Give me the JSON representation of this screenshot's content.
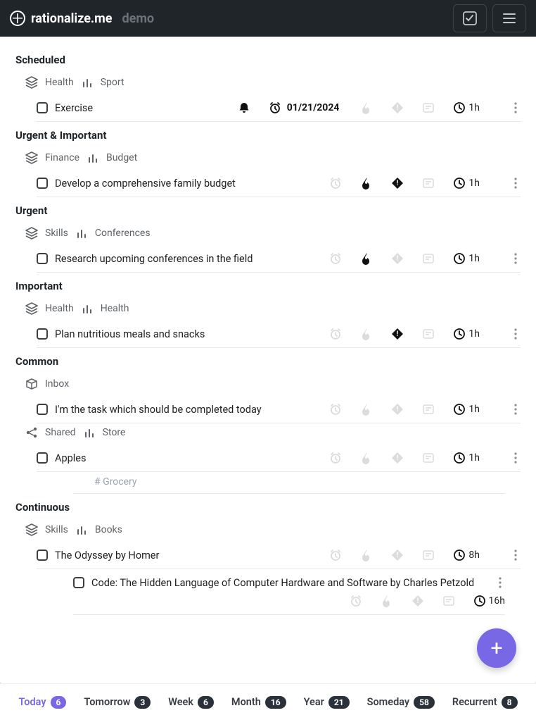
{
  "header": {
    "brand": "rationalize.me",
    "demo": "demo"
  },
  "sections": [
    {
      "title": "Scheduled",
      "catIcon": "layers",
      "cat1": "Health",
      "cat2": "Sport",
      "tasks": [
        {
          "title": "Exercise",
          "bell": true,
          "alarm": true,
          "date": "01/21/2024",
          "fire": false,
          "diamond": false,
          "note": false,
          "dur": "1h"
        }
      ]
    },
    {
      "title": "Urgent & Important",
      "catIcon": "layers",
      "cat1": "Finance",
      "cat2": "Budget",
      "tasks": [
        {
          "title": "Develop a comprehensive family budget",
          "alarm": false,
          "fire": true,
          "diamond": true,
          "note": false,
          "dur": "1h"
        }
      ]
    },
    {
      "title": "Urgent",
      "catIcon": "layers",
      "cat1": "Skills",
      "cat2": "Conferences",
      "tasks": [
        {
          "title": "Research upcoming conferences in the field",
          "alarm": false,
          "fire": true,
          "diamond": false,
          "note": false,
          "dur": "1h"
        }
      ]
    },
    {
      "title": "Important",
      "catIcon": "layers",
      "cat1": "Health",
      "cat2": "Health",
      "tasks": [
        {
          "title": "Plan nutritious meals and snacks",
          "alarm": false,
          "fire": false,
          "diamond": true,
          "note": false,
          "dur": "1h"
        }
      ]
    },
    {
      "title": "Common",
      "groups": [
        {
          "catIcon": "box",
          "cat1": "Inbox",
          "cat2": "",
          "tasks": [
            {
              "title": "I'm the task which should be completed today",
              "alarm": false,
              "fire": false,
              "diamond": false,
              "note": false,
              "dur": "1h"
            }
          ]
        },
        {
          "catIcon": "share",
          "cat1": "Shared",
          "cat2": "Store",
          "tasks": [
            {
              "title": "Apples",
              "alarm": false,
              "fire": false,
              "diamond": false,
              "note": false,
              "dur": "1h",
              "tag": "# Grocery"
            }
          ]
        }
      ]
    },
    {
      "title": "Continuous",
      "catIcon": "layers",
      "cat1": "Skills",
      "cat2": "Books",
      "tasks": [
        {
          "title": "The Odyssey by Homer",
          "alarm": false,
          "fire": false,
          "diamond": false,
          "note": false,
          "dur": "8h"
        },
        {
          "title": "Code: The Hidden Language of Computer Hardware and Software by Charles Petzold",
          "alarm": false,
          "fire": false,
          "diamond": false,
          "note": false,
          "dur": "16h",
          "multiline": true
        }
      ]
    }
  ],
  "tabs": [
    {
      "label": "Today",
      "count": "6",
      "active": true
    },
    {
      "label": "Tomorrow",
      "count": "3"
    },
    {
      "label": "Week",
      "count": "6"
    },
    {
      "label": "Month",
      "count": "16"
    },
    {
      "label": "Year",
      "count": "21"
    },
    {
      "label": "Someday",
      "count": "58"
    },
    {
      "label": "Recurrent",
      "count": "8"
    }
  ]
}
